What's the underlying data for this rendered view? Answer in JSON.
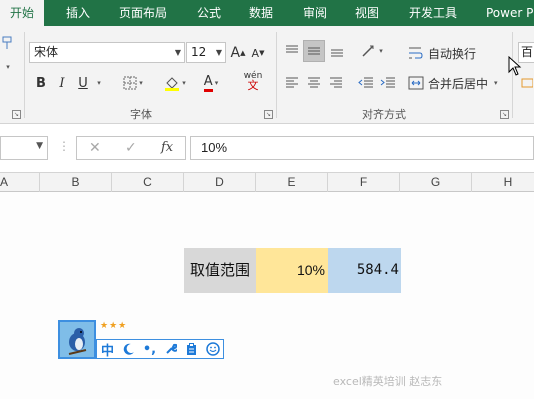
{
  "ribbon_tabs": [
    "开始",
    "插入",
    "页面布局",
    "公式",
    "数据",
    "审阅",
    "视图",
    "开发工具",
    "Power P"
  ],
  "active_tab": "开始",
  "font_group": {
    "font_name": "宋体",
    "font_size": "12",
    "grow_label": "A",
    "shrink_label": "A",
    "bold_label": "B",
    "italic_label": "I",
    "underline_label": "U",
    "font_color_label": "A",
    "phonetic_label": "wén",
    "group_label": "字体"
  },
  "alignment_group": {
    "wrap_text_label": "自动换行",
    "merge_center_label": "合并后居中",
    "group_label": "对齐方式"
  },
  "number_group": {
    "format_partial": "百"
  },
  "formula_bar": {
    "name_box": "",
    "cancel_symbol": "✕",
    "enter_symbol": "✓",
    "fx_label": "fx",
    "formula": "10%"
  },
  "columns": [
    "A",
    "B",
    "C",
    "D",
    "E",
    "F",
    "G",
    "H"
  ],
  "cells": {
    "label": "取值范围",
    "percent": "10%",
    "value": "584.4"
  },
  "colors": {
    "ribbon_green": "#217346",
    "label_fill": "#d8d8d8",
    "percent_fill": "#ffe699",
    "value_fill": "#bdd7ee",
    "ime_blue": "#1e7ad8"
  },
  "ime_toolbar": {
    "stars": "★★★",
    "mode_label": "中",
    "buttons": [
      "moon-icon",
      "punctuation-icon",
      "wrench-icon",
      "clipboard-icon",
      "smiley-icon"
    ],
    "punct_label": "•,"
  },
  "watermark": "excel精英培训 赵志东"
}
